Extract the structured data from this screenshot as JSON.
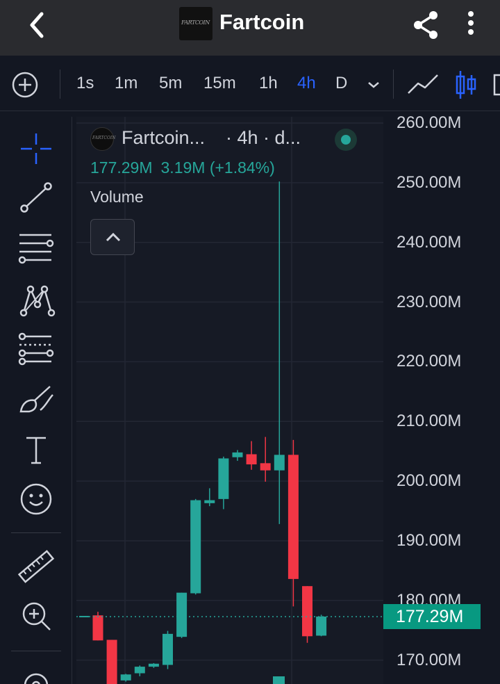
{
  "header": {
    "title": "Fartcoin",
    "logo_text": "FARTCOIN",
    "icons": [
      "back-arrow-icon",
      "share-icon",
      "more-vertical-icon"
    ]
  },
  "toolbar": {
    "timeframes": [
      "1s",
      "1m",
      "5m",
      "15m",
      "1h",
      "4h",
      "D"
    ],
    "active_timeframe": "4h",
    "icons": [
      "add-circle-icon",
      "chevron-down-icon",
      "line-chart-icon",
      "candlestick-icon"
    ]
  },
  "drawing_tools": [
    "crosshair-icon",
    "trend-line-icon",
    "horizontal-lines-icon",
    "pattern-icon",
    "fib-retracement-icon",
    "brush-icon",
    "text-icon",
    "emoji-icon",
    "ruler-icon",
    "zoom-in-icon"
  ],
  "legend": {
    "symbol": "Fartcoin...",
    "interval": "· 4h · d...",
    "last_value": "177.29M",
    "change": "3.19M (+1.84%)",
    "indicator": "Volume"
  },
  "colors": {
    "up": "#26a69a",
    "down": "#f23645",
    "accent": "#2962ff",
    "background": "#131722"
  },
  "chart_data": {
    "type": "candlestick",
    "unit": "M",
    "yticks": [
      "260.00M",
      "250.00M",
      "240.00M",
      "230.00M",
      "220.00M",
      "210.00M",
      "200.00M",
      "190.00M",
      "180.00M",
      "170.00M"
    ],
    "ylim": [
      167,
      262
    ],
    "last_price_label": "177.29M",
    "last_price": 177.29,
    "candles": [
      {
        "o": 177.5,
        "h": 178.1,
        "l": 173.3,
        "c": 173.3
      },
      {
        "o": 173.4,
        "h": 173.4,
        "l": 164.6,
        "c": 164.8
      },
      {
        "o": 166.6,
        "h": 167.7,
        "l": 166.4,
        "c": 167.6
      },
      {
        "o": 167.8,
        "h": 169.1,
        "l": 167.3,
        "c": 168.9
      },
      {
        "o": 168.9,
        "h": 169.5,
        "l": 168.7,
        "c": 169.4
      },
      {
        "o": 169.2,
        "h": 174.9,
        "l": 168.5,
        "c": 174.4
      },
      {
        "o": 173.9,
        "h": 181.3,
        "l": 173.7,
        "c": 181.3
      },
      {
        "o": 181.2,
        "h": 197.0,
        "l": 181.0,
        "c": 196.8
      },
      {
        "o": 196.3,
        "h": 198.8,
        "l": 195.8,
        "c": 196.8
      },
      {
        "o": 197.0,
        "h": 204.1,
        "l": 195.3,
        "c": 203.8
      },
      {
        "o": 204.0,
        "h": 205.2,
        "l": 203.4,
        "c": 204.8
      },
      {
        "o": 204.5,
        "h": 206.7,
        "l": 201.9,
        "c": 202.8
      },
      {
        "o": 203.0,
        "h": 207.4,
        "l": 199.9,
        "c": 201.8
      },
      {
        "o": 201.8,
        "h": 250.2,
        "l": 192.8,
        "c": 204.4
      },
      {
        "o": 204.4,
        "h": 206.9,
        "l": 179.0,
        "c": 183.6
      },
      {
        "o": 182.4,
        "h": 182.4,
        "l": 172.9,
        "c": 174.0
      },
      {
        "o": 174.1,
        "h": 177.6,
        "l": 174.0,
        "c": 177.3
      }
    ]
  }
}
